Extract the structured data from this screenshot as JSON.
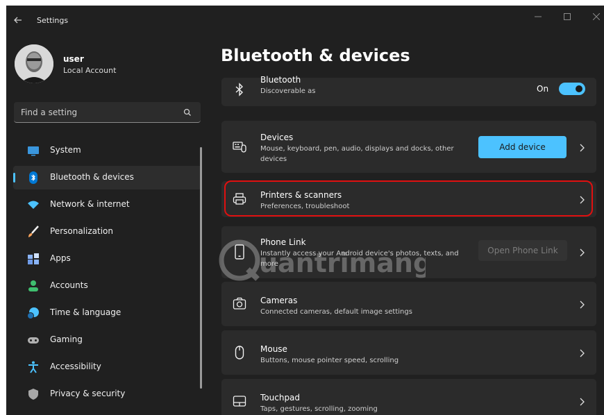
{
  "window": {
    "title": "Settings",
    "back_icon": "back-arrow-icon",
    "controls": [
      "minimize-icon",
      "maximize-icon",
      "close-icon"
    ]
  },
  "profile": {
    "name": "user",
    "account_type": "Local Account"
  },
  "search": {
    "placeholder": "Find a setting",
    "icon": "search-icon"
  },
  "nav": {
    "items": [
      {
        "label": "System",
        "icon": "monitor-icon",
        "color": "#3a96dd"
      },
      {
        "label": "Bluetooth & devices",
        "icon": "bluetooth-icon",
        "color": "#0078d4",
        "active": true
      },
      {
        "label": "Network & internet",
        "icon": "wifi-icon",
        "color": "#4cc2ff"
      },
      {
        "label": "Personalization",
        "icon": "brush-icon",
        "color": "#f7a35c"
      },
      {
        "label": "Apps",
        "icon": "apps-icon",
        "color": "#8ab4f8"
      },
      {
        "label": "Accounts",
        "icon": "person-icon",
        "color": "#3fbf6f"
      },
      {
        "label": "Time & language",
        "icon": "globe-clock-icon",
        "color": "#4cc2ff"
      },
      {
        "label": "Gaming",
        "icon": "gamepad-icon",
        "color": "#9e9e9e"
      },
      {
        "label": "Accessibility",
        "icon": "accessibility-icon",
        "color": "#4cc2ff"
      },
      {
        "label": "Privacy & security",
        "icon": "shield-icon",
        "color": "#9e9e9e"
      }
    ]
  },
  "main": {
    "page_title": "Bluetooth & devices",
    "bluetooth": {
      "title": "Bluetooth",
      "description": "Discoverable as",
      "toggle_label": "On",
      "toggle_on": true
    },
    "cards": {
      "devices": {
        "title": "Devices",
        "description": "Mouse, keyboard, pen, audio, displays and docks, other devices",
        "button": "Add device"
      },
      "printers": {
        "title": "Printers & scanners",
        "description": "Preferences, troubleshoot"
      },
      "phone_link": {
        "title": "Phone Link",
        "description": "Instantly access your Android device's photos, texts, and more",
        "button": "Open Phone Link"
      },
      "cameras": {
        "title": "Cameras",
        "description": "Connected cameras, default image settings"
      },
      "mouse": {
        "title": "Mouse",
        "description": "Buttons, mouse pointer speed, scrolling"
      },
      "touchpad": {
        "title": "Touchpad",
        "description": "Taps, gestures, scrolling, zooming"
      }
    }
  },
  "watermark": {
    "text": "Quantrimang"
  },
  "colors": {
    "accent": "#4cc2ff",
    "background": "#202020",
    "card": "#2b2b2b",
    "highlight": "#e01010"
  }
}
